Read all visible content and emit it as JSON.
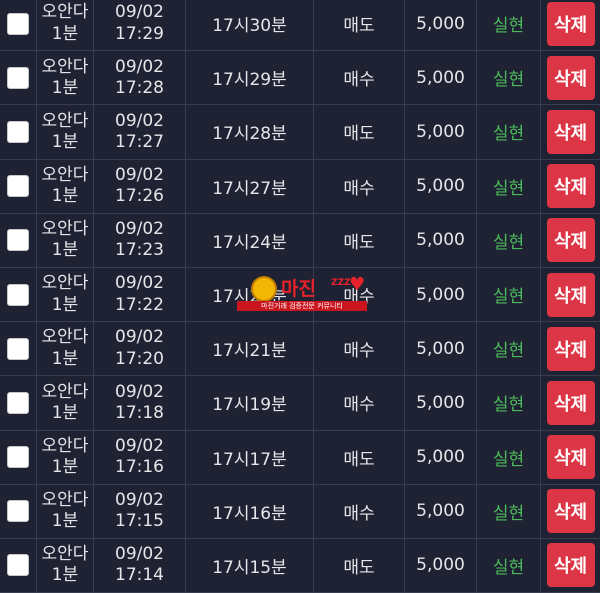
{
  "rows": [
    {
      "name1": "오안다",
      "name2": "1분",
      "date": "09/02",
      "time": "17:29",
      "target": "17시30분",
      "side": "매도",
      "amount": "5,000",
      "result": "실현",
      "delete": "삭제"
    },
    {
      "name1": "오안다",
      "name2": "1분",
      "date": "09/02",
      "time": "17:28",
      "target": "17시29분",
      "side": "매수",
      "amount": "5,000",
      "result": "실현",
      "delete": "삭제"
    },
    {
      "name1": "오안다",
      "name2": "1분",
      "date": "09/02",
      "time": "17:27",
      "target": "17시28분",
      "side": "매도",
      "amount": "5,000",
      "result": "실현",
      "delete": "삭제"
    },
    {
      "name1": "오안다",
      "name2": "1분",
      "date": "09/02",
      "time": "17:26",
      "target": "17시27분",
      "side": "매수",
      "amount": "5,000",
      "result": "실현",
      "delete": "삭제"
    },
    {
      "name1": "오안다",
      "name2": "1분",
      "date": "09/02",
      "time": "17:23",
      "target": "17시24분",
      "side": "매도",
      "amount": "5,000",
      "result": "실현",
      "delete": "삭제"
    },
    {
      "name1": "오안다",
      "name2": "1분",
      "date": "09/02",
      "time": "17:22",
      "target": "17시23분",
      "side": "매수",
      "amount": "5,000",
      "result": "실현",
      "delete": "삭제"
    },
    {
      "name1": "오안다",
      "name2": "1분",
      "date": "09/02",
      "time": "17:20",
      "target": "17시21분",
      "side": "매수",
      "amount": "5,000",
      "result": "실현",
      "delete": "삭제"
    },
    {
      "name1": "오안다",
      "name2": "1분",
      "date": "09/02",
      "time": "17:18",
      "target": "17시19분",
      "side": "매수",
      "amount": "5,000",
      "result": "실현",
      "delete": "삭제"
    },
    {
      "name1": "오안다",
      "name2": "1분",
      "date": "09/02",
      "time": "17:16",
      "target": "17시17분",
      "side": "매도",
      "amount": "5,000",
      "result": "실현",
      "delete": "삭제"
    },
    {
      "name1": "오안다",
      "name2": "1분",
      "date": "09/02",
      "time": "17:15",
      "target": "17시16분",
      "side": "매수",
      "amount": "5,000",
      "result": "실현",
      "delete": "삭제"
    },
    {
      "name1": "오안다",
      "name2": "1분",
      "date": "09/02",
      "time": "17:14",
      "target": "17시15분",
      "side": "매도",
      "amount": "5,000",
      "result": "실현",
      "delete": "삭제"
    }
  ],
  "watermark": {
    "brand": "마진",
    "tag": "ZZZ",
    "strip": "마진거래 검증전문 커뮤니티"
  },
  "colors": {
    "background": "#1f2232",
    "result_green": "#4cbb5c",
    "delete_red": "#dc3545"
  }
}
